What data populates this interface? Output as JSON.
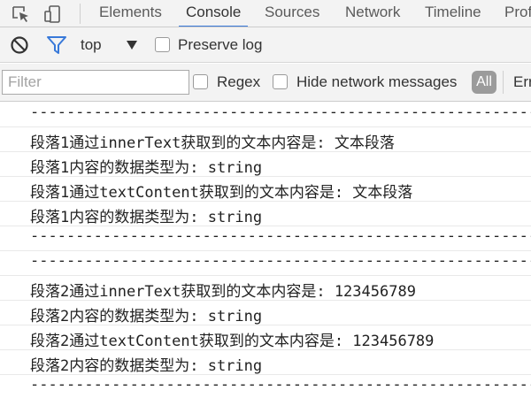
{
  "devtools": {
    "tabs": [
      {
        "label": "Elements",
        "active": false
      },
      {
        "label": "Console",
        "active": true
      },
      {
        "label": "Sources",
        "active": false
      },
      {
        "label": "Network",
        "active": false
      },
      {
        "label": "Timeline",
        "active": false
      },
      {
        "label": "Prof",
        "active": false
      }
    ],
    "toolbar_icons": [
      "element-picker-icon",
      "device-toolbar-icon"
    ]
  },
  "console_toolbar": {
    "clear_icon": "no-entry-icon",
    "filter_icon": "funnel-icon",
    "context": "top",
    "preserve_log_label": "Preserve log",
    "preserve_log_checked": false
  },
  "filter_bar": {
    "placeholder": "Filter",
    "value": "",
    "regex_label": "Regex",
    "hide_network_label": "Hide network messages",
    "level_all": "All",
    "level_errors": "Err"
  },
  "colors": {
    "accent": "#3879d9",
    "filter_icon": "#3879d9",
    "toolbar_bg": "#f3f3f3"
  },
  "console_lines": [
    "------------------------------------------------------------",
    "段落1通过innerText获取到的文本内容是: 文本段落",
    "段落1内容的数据类型为: string",
    "段落1通过textContent获取到的文本内容是: 文本段落",
    "段落1内容的数据类型为: string",
    "------------------------------------------------------------",
    "------------------------------------------------------------",
    "段落2通过innerText获取到的文本内容是: 123456789",
    "段落2内容的数据类型为: string",
    "段落2通过textContent获取到的文本内容是: 123456789",
    "段落2内容的数据类型为: string",
    "------------------------------------------------------------"
  ]
}
